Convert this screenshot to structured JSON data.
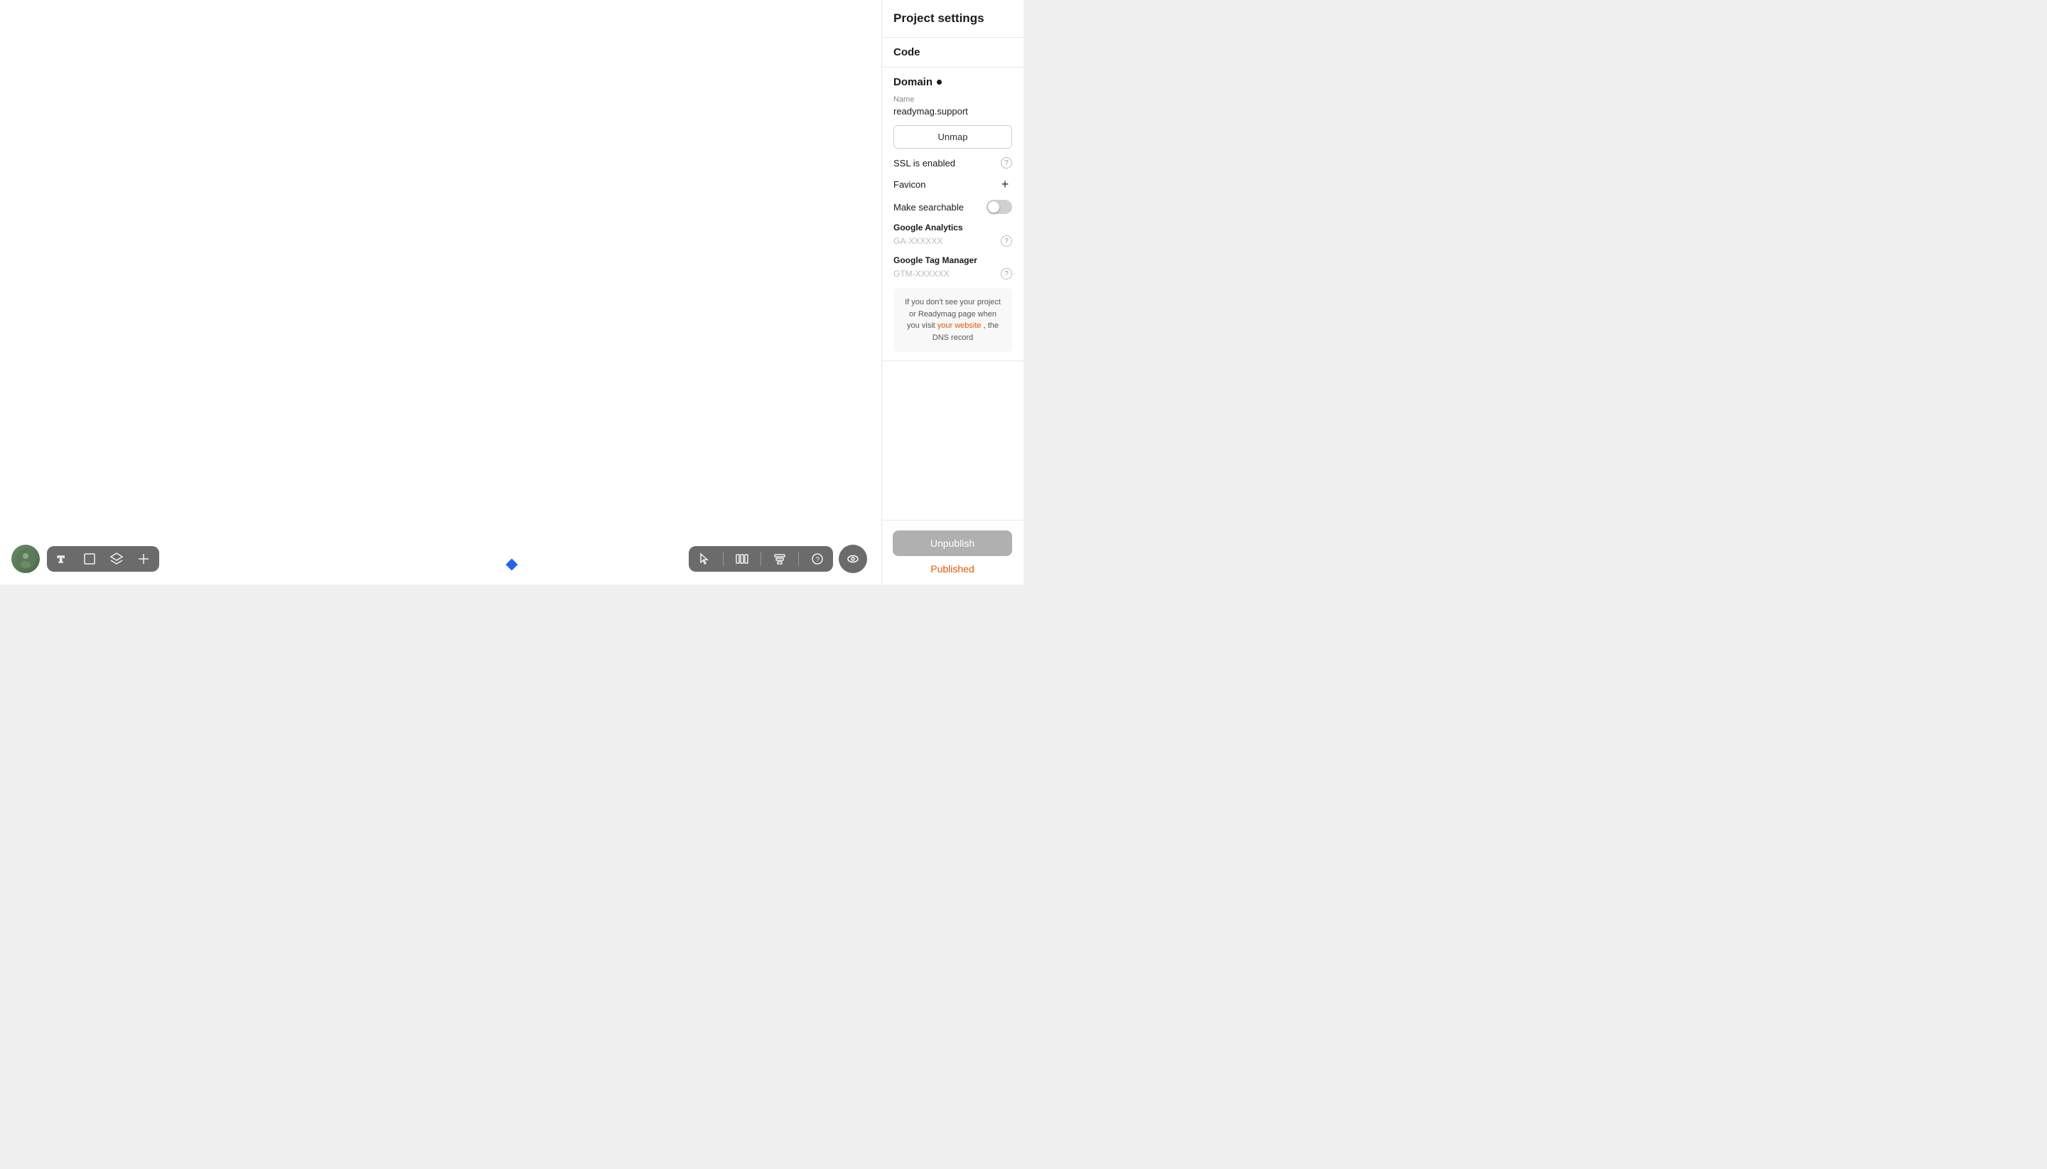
{
  "panel": {
    "title": "Project settings",
    "code_label": "Code",
    "domain": {
      "label": "Domain",
      "has_dot": true,
      "name_label": "Name",
      "name_value": "readymag.support",
      "unmap_btn": "Unmap"
    },
    "ssl": {
      "label": "SSL is enabled"
    },
    "favicon": {
      "label": "Favicon"
    },
    "searchable": {
      "label": "Make searchable",
      "enabled": false
    },
    "google_analytics": {
      "label": "Google Analytics",
      "placeholder": "GA-XXXXXX"
    },
    "google_tag_manager": {
      "label": "Google Tag Manager",
      "placeholder": "GTM-XXXXXX"
    },
    "info_box": {
      "text_before": "If you don't see your project or Readymag page when you visit ",
      "link_text": "your website",
      "text_after": ", the DNS record"
    },
    "unpublish_btn": "Unpublish",
    "published_label": "Published"
  },
  "toolbar_left": {
    "tools": [
      {
        "name": "text-tool",
        "label": "T"
      },
      {
        "name": "frame-tool",
        "label": "□"
      },
      {
        "name": "layers-tool",
        "label": "◈"
      },
      {
        "name": "add-tool",
        "label": "+"
      }
    ]
  },
  "toolbar_right": {
    "tools": [
      {
        "name": "select-tool",
        "label": "cursor"
      },
      {
        "name": "columns-tool",
        "label": "columns"
      },
      {
        "name": "align-tool",
        "label": "align"
      },
      {
        "name": "help-tool",
        "label": "?"
      }
    ],
    "eye_tool": "eye"
  },
  "colors": {
    "accent_orange": "#e05a00",
    "accent_blue": "#2563eb",
    "toolbar_bg": "#6b6b6b",
    "toggle_off": "#d0d0d0",
    "unpublish_bg": "#b0b0b0"
  }
}
